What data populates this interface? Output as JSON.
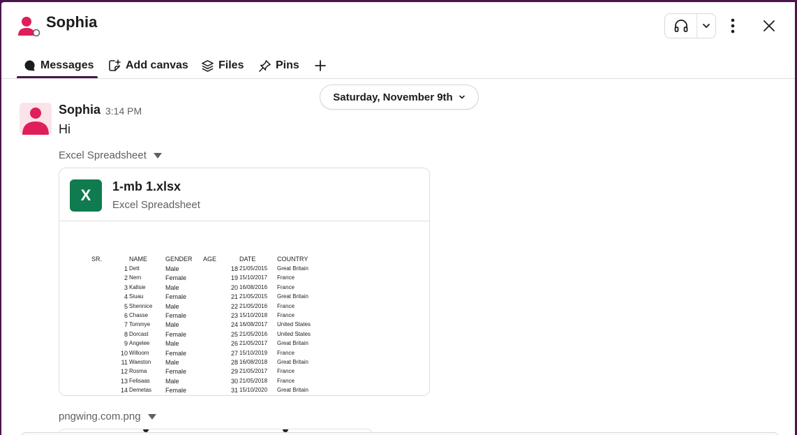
{
  "header": {
    "title": "Sophia",
    "avatar_icon": "user-avatar-icon",
    "status_icon": "away-status-icon",
    "huddle_icon": "headphones-icon",
    "more_icon": "kebab-menu-icon",
    "close_icon": "close-icon"
  },
  "tabs": [
    {
      "label": "Messages",
      "icon": "message-bubble-icon",
      "active": true
    },
    {
      "label": "Add canvas",
      "icon": "add-canvas-icon",
      "active": false
    },
    {
      "label": "Files",
      "icon": "layers-icon",
      "active": false
    },
    {
      "label": "Pins",
      "icon": "pin-icon",
      "active": false
    }
  ],
  "date_divider": "Saturday, November 9th",
  "message": {
    "sender": "Sophia",
    "time": "3:14 PM",
    "text": "Hi",
    "attachment_label": "Excel Spreadsheet",
    "file": {
      "icon_letter": "X",
      "name": "1-mb 1.xlsx",
      "type": "Excel Spreadsheet"
    },
    "png_label": "pngwing.com.png"
  },
  "spreadsheet": {
    "headers": {
      "sr": "SR.",
      "name": "NAME",
      "gender": "GENDER",
      "age": "AGE",
      "date": "DATE",
      "country": "COUNTRY"
    },
    "rows": [
      {
        "sr": "1",
        "name": "Dett",
        "gender": "Male",
        "age": "18",
        "date": "21/05/2015",
        "country": "Great Britain"
      },
      {
        "sr": "2",
        "name": "Nern",
        "gender": "Female",
        "age": "19",
        "date": "15/10/2017",
        "country": "France"
      },
      {
        "sr": "3",
        "name": "Kallsie",
        "gender": "Male",
        "age": "20",
        "date": "16/08/2016",
        "country": "France"
      },
      {
        "sr": "4",
        "name": "Siuau",
        "gender": "Female",
        "age": "21",
        "date": "21/05/2015",
        "country": "Great Britain"
      },
      {
        "sr": "5",
        "name": "Shennice",
        "gender": "Male",
        "age": "22",
        "date": "21/05/2016",
        "country": "France"
      },
      {
        "sr": "6",
        "name": "Chasse",
        "gender": "Female",
        "age": "23",
        "date": "15/10/2018",
        "country": "France"
      },
      {
        "sr": "7",
        "name": "Tommye",
        "gender": "Male",
        "age": "24",
        "date": "16/08/2017",
        "country": "United States"
      },
      {
        "sr": "8",
        "name": "Dorcast",
        "gender": "Female",
        "age": "25",
        "date": "21/05/2016",
        "country": "United States"
      },
      {
        "sr": "9",
        "name": "Angelee",
        "gender": "Male",
        "age": "26",
        "date": "21/05/2017",
        "country": "Great Britain"
      },
      {
        "sr": "10",
        "name": "Willoom",
        "gender": "Female",
        "age": "27",
        "date": "15/10/2019",
        "country": "France"
      },
      {
        "sr": "11",
        "name": "Waeston",
        "gender": "Male",
        "age": "28",
        "date": "16/08/2018",
        "country": "Great Britain"
      },
      {
        "sr": "12",
        "name": "Rosma",
        "gender": "Female",
        "age": "29",
        "date": "21/05/2017",
        "country": "France"
      },
      {
        "sr": "13",
        "name": "Felisaas",
        "gender": "Male",
        "age": "30",
        "date": "21/05/2018",
        "country": "France"
      },
      {
        "sr": "14",
        "name": "Demetas",
        "gender": "Female",
        "age": "31",
        "date": "15/10/2020",
        "country": "Great Britain"
      }
    ]
  },
  "colors": {
    "accent": "#4a154b",
    "avatar": "#e01e5a",
    "excel": "#0f7b4e"
  }
}
